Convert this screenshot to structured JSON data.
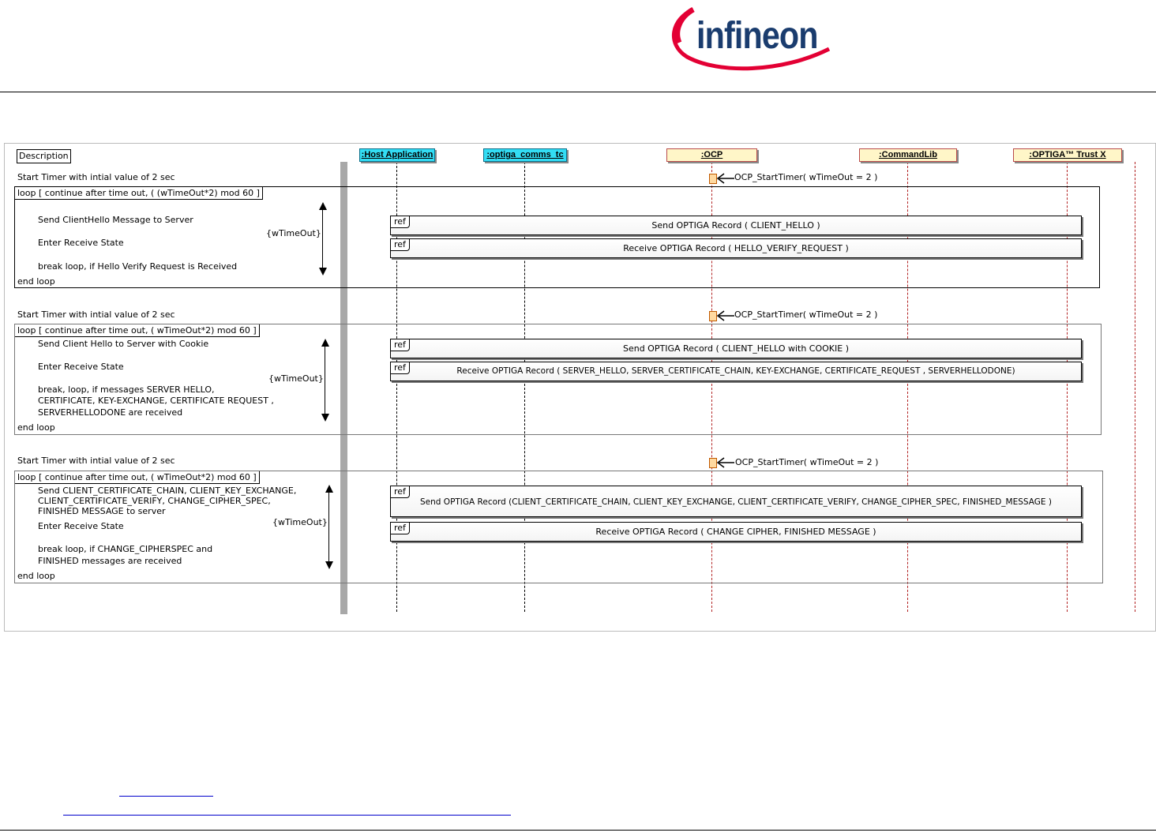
{
  "header": {
    "brand": "infineon",
    "accent_color": "#e30034",
    "brand_color": "#1a3c6e"
  },
  "diagram": {
    "description_label": "Description",
    "actors": [
      ":Host Application",
      ":optiga_comms_tc",
      ":OCP",
      ":CommandLib",
      ":OPTIGA™ Trust X"
    ],
    "sections": [
      {
        "timer_note": "Start Timer with intial value of 2 sec",
        "timer_call": "OCP_StartTimer( wTimeOut = 2 )",
        "loop_label": "loop [ continue after time out, ( (wTimeOut*2) mod 60 ]",
        "steps": [
          "Send ClientHello Message to Server",
          "Enter Receive State",
          "break loop, if Hello Verify Request is Received"
        ],
        "timeout_label": "{wTimeOut}",
        "end_label": "end loop",
        "refs": [
          {
            "tag": "ref",
            "text": "Send OPTIGA Record ( CLIENT_HELLO )"
          },
          {
            "tag": "ref",
            "text": "Receive OPTIGA Record ( HELLO_VERIFY_REQUEST )"
          }
        ]
      },
      {
        "timer_note": "Start Timer with intial value of 2 sec",
        "timer_call": "OCP_StartTimer( wTimeOut = 2 )",
        "loop_label": "loop [ continue after time out, ( wTimeOut*2) mod 60 ]",
        "steps": [
          "Send Client Hello to Server with Cookie",
          "Enter Receive State",
          "break, loop, if messages SERVER HELLO,",
          "CERTIFICATE, KEY-EXCHANGE, CERTIFICATE REQUEST ,",
          "SERVERHELLODONE are received"
        ],
        "timeout_label": "{wTimeOut}",
        "end_label": "end loop",
        "refs": [
          {
            "tag": "ref",
            "text": "Send OPTIGA Record ( CLIENT_HELLO with COOKIE )"
          },
          {
            "tag": "ref",
            "text": "Receive OPTIGA Record ( SERVER_HELLO, SERVER_CERTIFICATE_CHAIN, KEY-EXCHANGE, CERTIFICATE_REQUEST , SERVERHELLODONE)"
          }
        ]
      },
      {
        "timer_note": "Start Timer with intial value of 2 sec",
        "timer_call": "OCP_StartTimer( wTimeOut = 2 )",
        "loop_label": "loop [ continue after time out, ( wTimeOut*2) mod 60 ]",
        "steps": [
          "Send CLIENT_CERTIFICATE_CHAIN, CLIENT_KEY_EXCHANGE,",
          "CLIENT_CERTIFICATE_VERIFY, CHANGE_CIPHER_SPEC,",
          "FINISHED MESSAGE to server",
          "Enter Receive State",
          "break loop, if CHANGE_CIPHERSPEC and",
          "FINISHED messages are received"
        ],
        "timeout_label": "{wTimeOut}",
        "end_label": "end loop",
        "refs": [
          {
            "tag": "ref",
            "text": "Send OPTIGA Record (CLIENT_CERTIFICATE_CHAIN, CLIENT_KEY_EXCHANGE, CLIENT_CERTIFICATE_VERIFY, CHANGE_CIPHER_SPEC,  FINISHED_MESSAGE )"
          },
          {
            "tag": "ref",
            "text": "Receive OPTIGA Record ( CHANGE CIPHER, FINISHED MESSAGE )"
          }
        ]
      }
    ]
  }
}
